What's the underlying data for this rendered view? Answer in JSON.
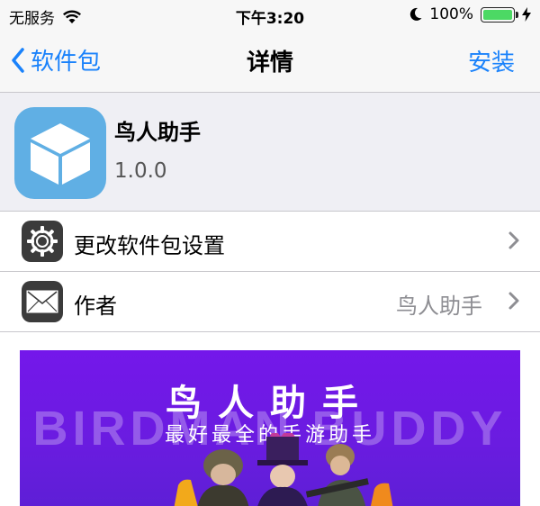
{
  "status_bar": {
    "carrier": "无服务",
    "time": "下午3:20",
    "battery": "100%",
    "battery_level": 1.0
  },
  "nav": {
    "back_label": "软件包",
    "title": "详情",
    "action_label": "安装"
  },
  "package": {
    "name": "鸟人助手",
    "version": "1.0.0",
    "icon": "package-box-icon",
    "icon_color": "#60afe4"
  },
  "rows": [
    {
      "label": "更改软件包设置",
      "detail": "",
      "icon": "gear-icon"
    },
    {
      "label": "作者",
      "detail": "鸟人助手",
      "icon": "mail-icon"
    }
  ],
  "banner": {
    "title": "鸟人助手",
    "subtitle": "最好最全的手游助手",
    "background_text": "BIRDMAN BUDDY"
  },
  "colors": {
    "accent": "#1a82fb",
    "banner_purple": "#7417ea",
    "battery_green": "#4cd964"
  }
}
